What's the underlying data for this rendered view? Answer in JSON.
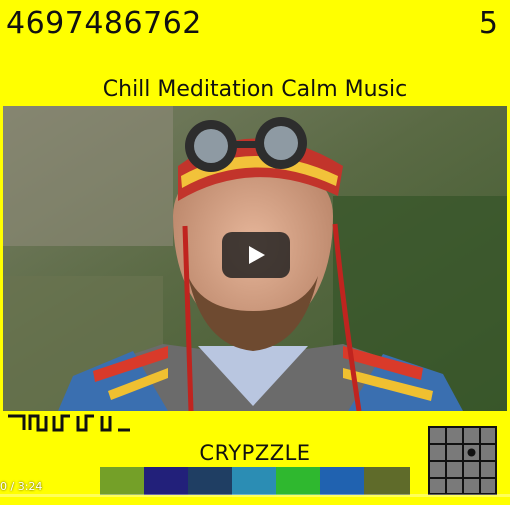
{
  "header": {
    "number": "4697486762",
    "count": "5",
    "title": "Chill Meditation Calm Music"
  },
  "player": {
    "play_icon": "play-icon",
    "time_display": "0 / 3:24",
    "progress": 0
  },
  "footer": {
    "glyph_icon": "glyph-pattern-icon",
    "brand": "CRYPZZLE",
    "grid_icon": "grid-puzzle-icon",
    "swatches": [
      "#74a028",
      "#22207a",
      "#1f3e63",
      "#2b8db4",
      "#2fb82f",
      "#2062b0",
      "#5f6b2a"
    ]
  },
  "colors": {
    "background": "#ffff00",
    "text": "#111111"
  }
}
